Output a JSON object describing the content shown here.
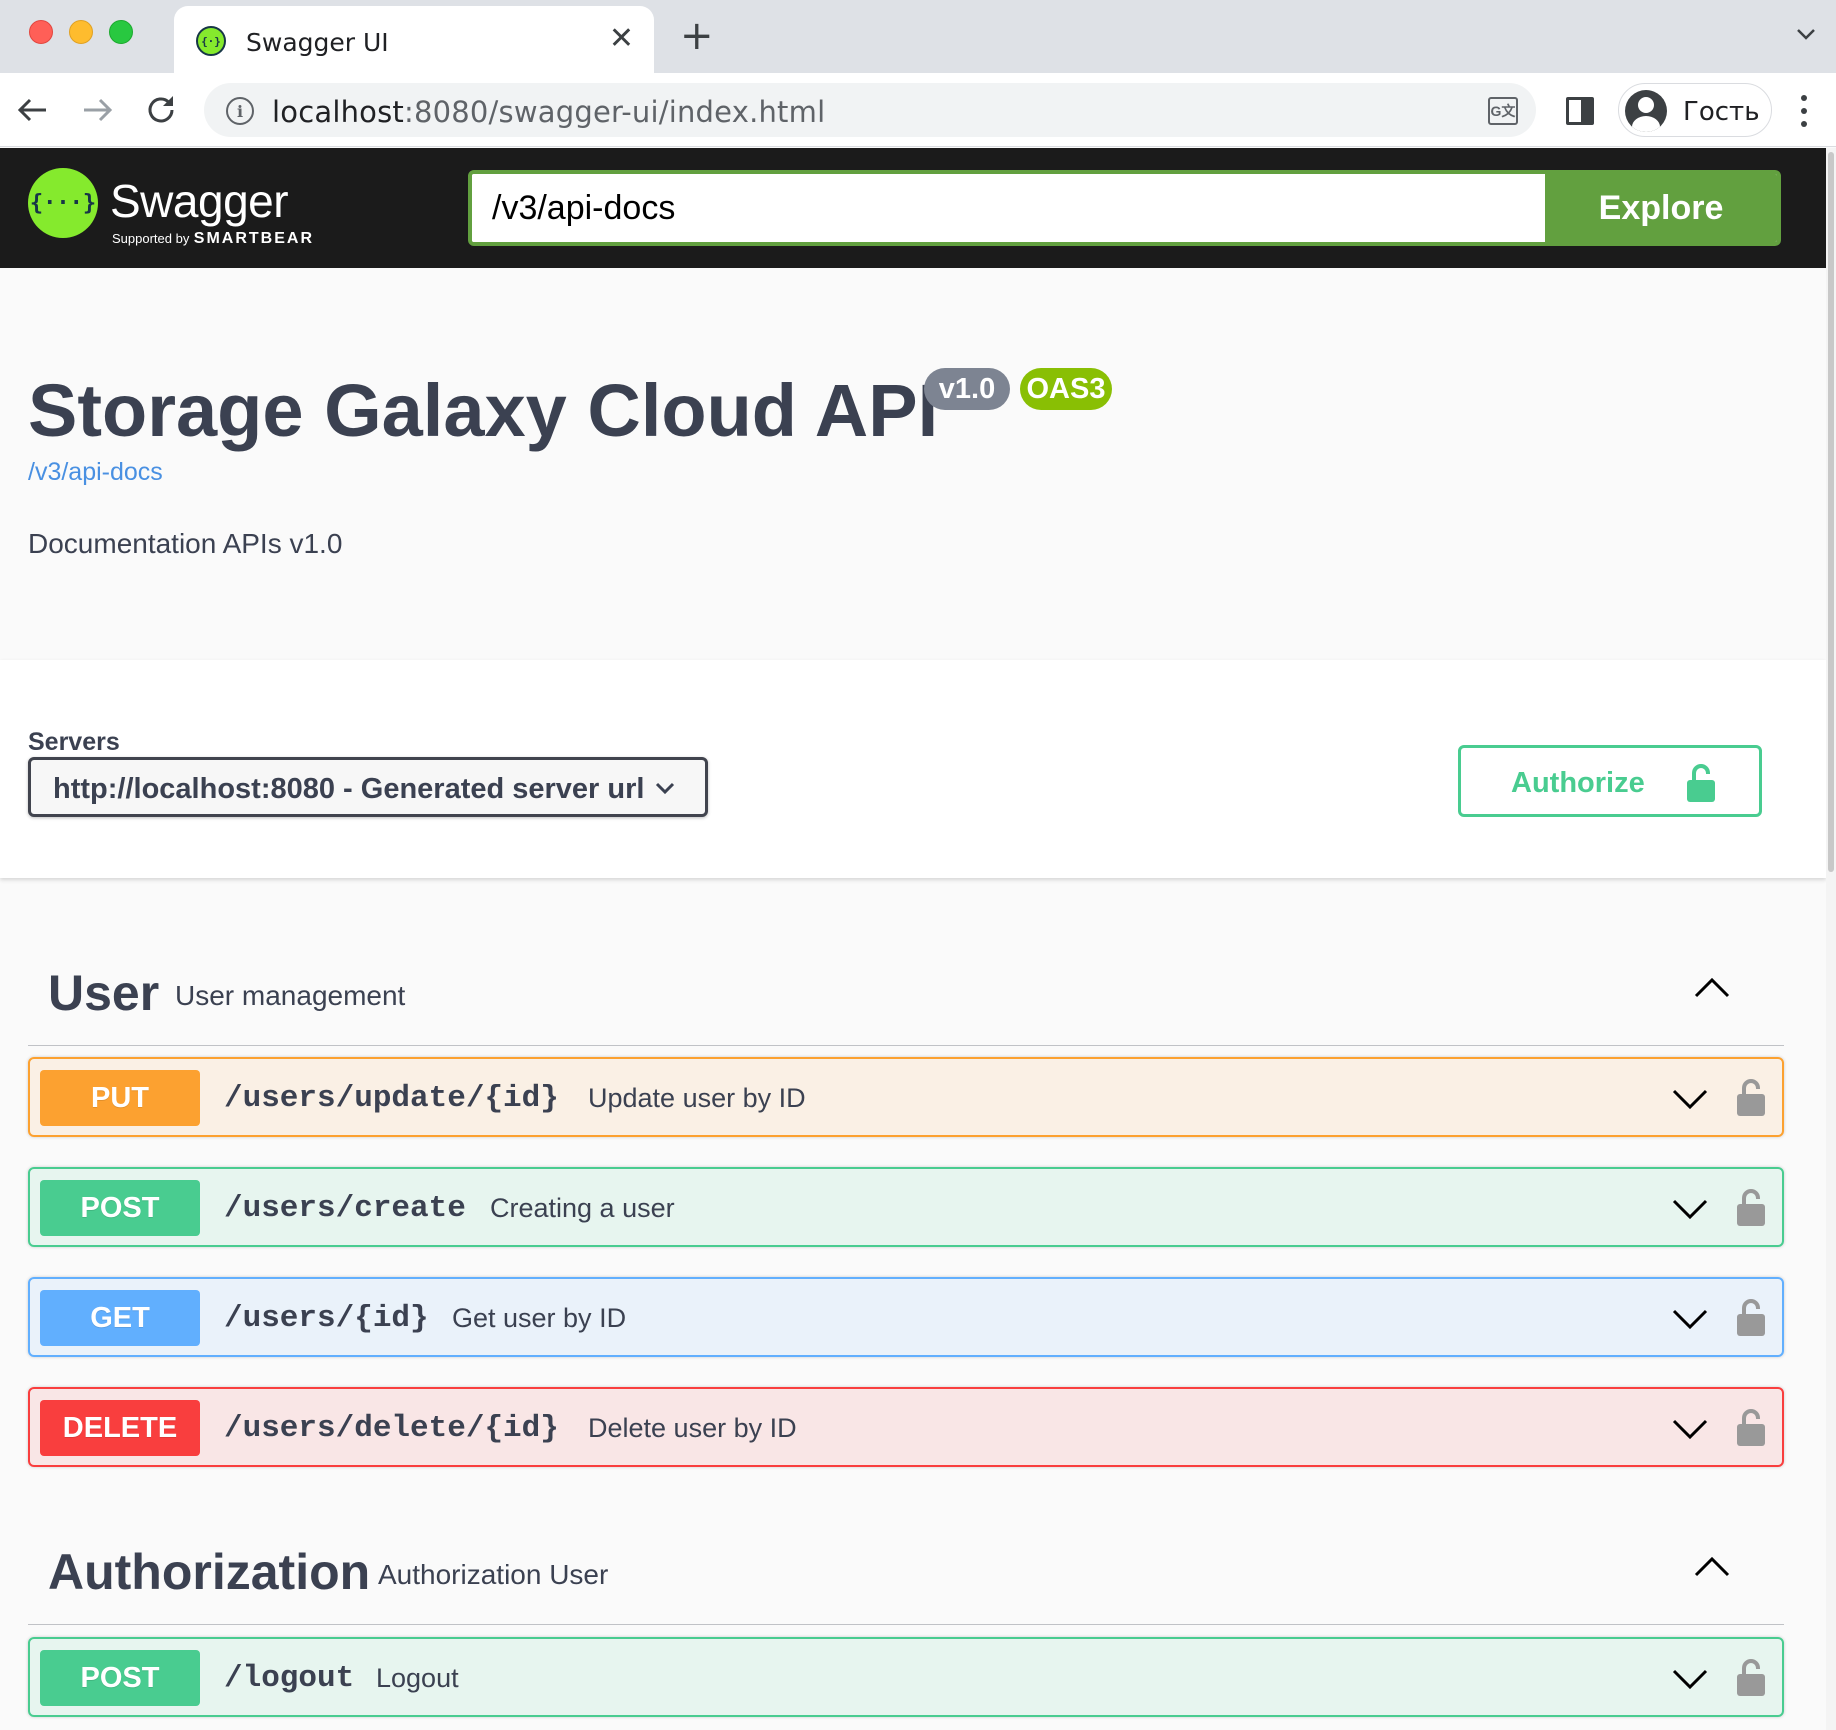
{
  "browser": {
    "tab_title": "Swagger UI",
    "url_host": "localhost",
    "url_rest": ":8080/swagger-ui/index.html",
    "profile_name": "Гость",
    "icons": [
      "back-icon",
      "forward-icon",
      "reload-icon",
      "info-icon",
      "translate-icon",
      "side-panel-icon",
      "profile-avatar-icon",
      "more-menu-icon",
      "close-tab-icon",
      "new-tab-icon",
      "tab-list-icon"
    ]
  },
  "topbar": {
    "logo_name": "Swagger",
    "logo_sub_prefix": "Supported by",
    "logo_sub_brand": "SMARTBEAR",
    "logo_glyph": "{···}",
    "search_value": "/v3/api-docs",
    "explore_label": "Explore",
    "colors": {
      "background": "#1b1b1b",
      "accent": "#62a03f",
      "logo": "#85ea2d"
    }
  },
  "info": {
    "title": "Storage Galaxy Cloud API",
    "version_badge": "v1.0",
    "oas_badge": "OAS3",
    "spec_link": "/v3/api-docs",
    "description": "Documentation APIs v1.0"
  },
  "servers": {
    "label": "Servers",
    "selected": "http://localhost:8080 - Generated server url",
    "authorize_label": "Authorize"
  },
  "tags": [
    {
      "name": "User",
      "description": "User management",
      "expanded": true,
      "operations": [
        {
          "method": "PUT",
          "path": "/users/update/{id}",
          "summary": "Update user by ID",
          "color": "#fca130"
        },
        {
          "method": "POST",
          "path": "/users/create",
          "summary": "Creating a user",
          "color": "#49cc90"
        },
        {
          "method": "GET",
          "path": "/users/{id}",
          "summary": "Get user by ID",
          "color": "#61affe"
        },
        {
          "method": "DELETE",
          "path": "/users/delete/{id}",
          "summary": "Delete user by ID",
          "color": "#f93e3e"
        }
      ]
    },
    {
      "name": "Authorization",
      "description": "Authorization User",
      "expanded": true,
      "operations": [
        {
          "method": "POST",
          "path": "/logout",
          "summary": "Logout",
          "color": "#49cc90"
        }
      ]
    }
  ]
}
